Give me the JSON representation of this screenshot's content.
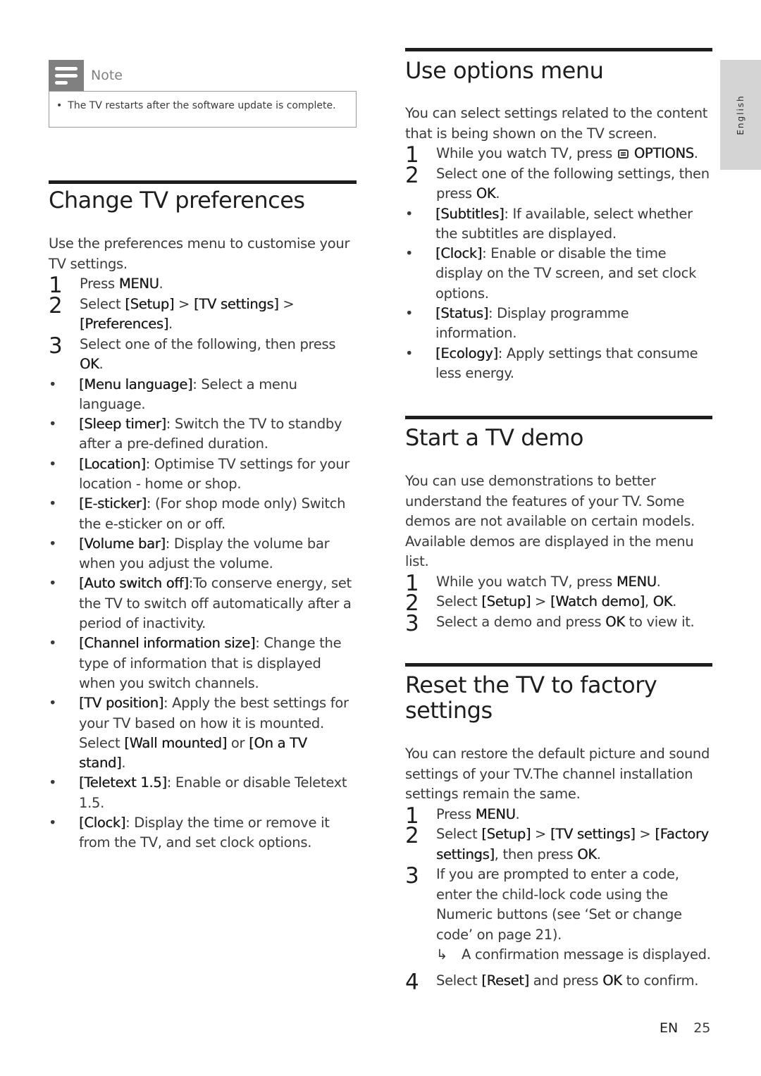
{
  "note": {
    "title": "Note",
    "icon": "note-icon",
    "items": [
      "The TV restarts after the software update is complete."
    ]
  },
  "language_tab": "English",
  "sections": {
    "change_prefs": {
      "title": "Change TV preferences",
      "intro": "Use the preferences menu to customise your TV settings.",
      "steps": [
        {
          "num": "1",
          "segments": [
            {
              "t": "Press "
            },
            {
              "t": "MENU",
              "b": true
            },
            {
              "t": "."
            }
          ]
        },
        {
          "num": "2",
          "segments": [
            {
              "t": "Select "
            },
            {
              "t": "[Setup]",
              "b": true
            },
            {
              "t": " > "
            },
            {
              "t": "[TV settings]",
              "b": true
            },
            {
              "t": " > "
            },
            {
              "t": "[Preferences]",
              "b": true
            },
            {
              "t": "."
            }
          ]
        },
        {
          "num": "3",
          "segments": [
            {
              "t": "Select one of the following, then press "
            },
            {
              "t": "OK",
              "b": true
            },
            {
              "t": "."
            }
          ]
        }
      ],
      "bullets": [
        [
          {
            "t": "[Menu language]",
            "b": true
          },
          {
            "t": ": Select a menu language."
          }
        ],
        [
          {
            "t": "[Sleep timer]",
            "b": true
          },
          {
            "t": ": Switch the TV to standby after a pre-defined duration."
          }
        ],
        [
          {
            "t": "[Location]",
            "b": true
          },
          {
            "t": ": Optimise TV settings for your location - home or shop."
          }
        ],
        [
          {
            "t": "[E-sticker]",
            "b": true
          },
          {
            "t": ": (For shop mode only) Switch the e-sticker on or off."
          }
        ],
        [
          {
            "t": "[Volume bar]",
            "b": true
          },
          {
            "t": ": Display the volume bar when you adjust the volume."
          }
        ],
        [
          {
            "t": "[Auto switch off]",
            "b": true
          },
          {
            "t": ":To conserve energy, set the TV to switch off automatically after a period of inactivity."
          }
        ],
        [
          {
            "t": "[Channel information size]",
            "b": true
          },
          {
            "t": ": Change the type of information that is displayed when you switch channels."
          }
        ],
        [
          {
            "t": "[TV position]",
            "b": true
          },
          {
            "t": ": Apply the best settings for your TV based on how it is mounted. Select "
          },
          {
            "t": "[Wall mounted]",
            "b": true
          },
          {
            "t": " or "
          },
          {
            "t": "[On a TV stand]",
            "b": true
          },
          {
            "t": "."
          }
        ],
        [
          {
            "t": "[Teletext 1.5]",
            "b": true
          },
          {
            "t": ": Enable or disable Teletext 1.5."
          }
        ],
        [
          {
            "t": "[Clock]",
            "b": true
          },
          {
            "t": ": Display the time or remove it from the TV, and set clock options."
          }
        ]
      ]
    },
    "options_menu": {
      "title": "Use options menu",
      "intro": "You can select settings related to the content that is being shown on the TV screen.",
      "steps": [
        {
          "num": "1",
          "segments": [
            {
              "t": "While you watch TV, press "
            },
            {
              "icon": "options-icon"
            },
            {
              "t": " OPTIONS",
              "b": true
            },
            {
              "t": "."
            }
          ]
        },
        {
          "num": "2",
          "segments": [
            {
              "t": "Select one of the following settings, then press "
            },
            {
              "t": "OK",
              "b": true
            },
            {
              "t": "."
            }
          ]
        }
      ],
      "bullets": [
        [
          {
            "t": "[Subtitles]",
            "b": true
          },
          {
            "t": ": If available, select whether the subtitles are displayed."
          }
        ],
        [
          {
            "t": "[Clock]",
            "b": true
          },
          {
            "t": ": Enable or disable the time display on the TV screen, and set clock options."
          }
        ],
        [
          {
            "t": "[Status]",
            "b": true
          },
          {
            "t": ": Display programme information."
          }
        ],
        [
          {
            "t": "[Ecology]",
            "b": true
          },
          {
            "t": ": Apply settings that consume less energy."
          }
        ]
      ]
    },
    "tv_demo": {
      "title": "Start a TV demo",
      "intro": "You can use demonstrations to better understand the features of your TV. Some demos are not available on certain models. Available demos are displayed in the menu list.",
      "steps": [
        {
          "num": "1",
          "segments": [
            {
              "t": "While you watch TV, press "
            },
            {
              "t": "MENU",
              "b": true
            },
            {
              "t": "."
            }
          ]
        },
        {
          "num": "2",
          "segments": [
            {
              "t": "Select "
            },
            {
              "t": "[Setup]",
              "b": true
            },
            {
              "t": " > "
            },
            {
              "t": "[Watch demo]",
              "b": true
            },
            {
              "t": ", "
            },
            {
              "t": "OK",
              "b": true
            },
            {
              "t": "."
            }
          ]
        },
        {
          "num": "3",
          "segments": [
            {
              "t": "Select a demo and press "
            },
            {
              "t": "OK",
              "b": true
            },
            {
              "t": " to view it."
            }
          ]
        }
      ]
    },
    "factory_reset": {
      "title": "Reset the TV to factory settings",
      "intro": "You can restore the default picture and sound settings of your TV.The channel installation settings remain the same.",
      "steps": [
        {
          "num": "1",
          "segments": [
            {
              "t": "Press "
            },
            {
              "t": "MENU",
              "b": true
            },
            {
              "t": "."
            }
          ]
        },
        {
          "num": "2",
          "segments": [
            {
              "t": "Select "
            },
            {
              "t": "[Setup]",
              "b": true
            },
            {
              "t": " > "
            },
            {
              "t": "[TV settings]",
              "b": true
            },
            {
              "t": " > "
            },
            {
              "t": "[Factory settings]",
              "b": true
            },
            {
              "t": ", then press "
            },
            {
              "t": "OK",
              "b": true
            },
            {
              "t": "."
            }
          ]
        },
        {
          "num": "3",
          "segments": [
            {
              "t": "If you are prompted to enter a code, enter the child-lock code using the Numeric buttons (see ‘Set or change code’ on page 21)."
            }
          ],
          "result": "A confirmation message is displayed."
        },
        {
          "num": "4",
          "segments": [
            {
              "t": "Select "
            },
            {
              "t": "[Reset]",
              "b": true
            },
            {
              "t": " and press "
            },
            {
              "t": "OK",
              "b": true
            },
            {
              "t": " to confirm."
            }
          ]
        }
      ]
    }
  },
  "footer": {
    "lang": "EN",
    "page": "25"
  }
}
